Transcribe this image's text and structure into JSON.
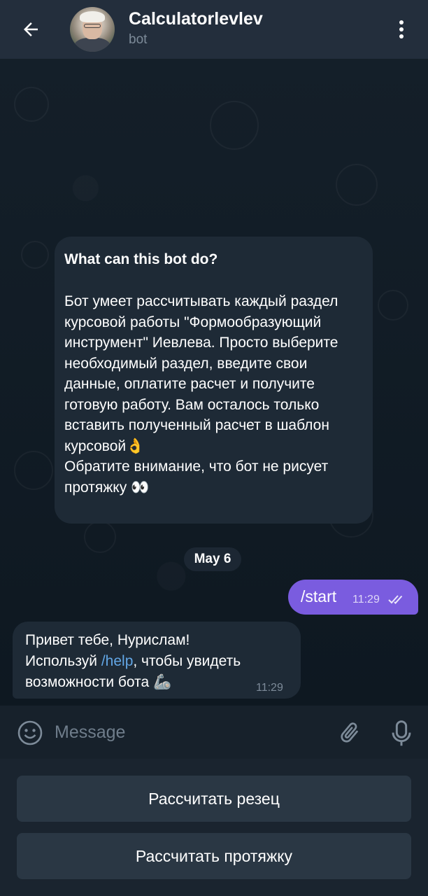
{
  "header": {
    "title": "Calculatorlevlev",
    "subtitle": "bot"
  },
  "chat": {
    "info": {
      "title": "What can this bot do?",
      "body": "Бот умеет рассчитывать каждый раздел курсовой работы \"Формообразующий инструмент\" Иевлева. Просто выберите необходимый раздел, введите свои данные, оплатите расчет и получите готовую работу.  Вам осталось только вставить полученный расчет в шаблон курсовой👌\nОбратите внимание, что бот не рисует протяжку 👀"
    },
    "date_separator": "May 6",
    "outgoing": {
      "text": "/start",
      "time": "11:29"
    },
    "incoming": {
      "line1": "Привет тебе, Нурислам!",
      "line2_prefix": "Используй ",
      "command": "/help",
      "line2_suffix": ", чтобы увидеть",
      "line3": "возможности бота 🦾",
      "time": "11:29"
    }
  },
  "input": {
    "placeholder": "Message"
  },
  "keyboard": {
    "buttons": [
      "Рассчитать резец",
      "Рассчитать протяжку"
    ]
  },
  "colors": {
    "header_bg": "#232e3c",
    "bubble_in": "#1e2a36",
    "bubble_out": "#7a5cdf",
    "link": "#62a6e5",
    "keyboard_button": "#2a3744"
  },
  "icons": [
    "back-arrow-icon",
    "more-vertical-icon",
    "emoji-icon",
    "paperclip-icon",
    "microphone-icon",
    "double-check-icon"
  ]
}
